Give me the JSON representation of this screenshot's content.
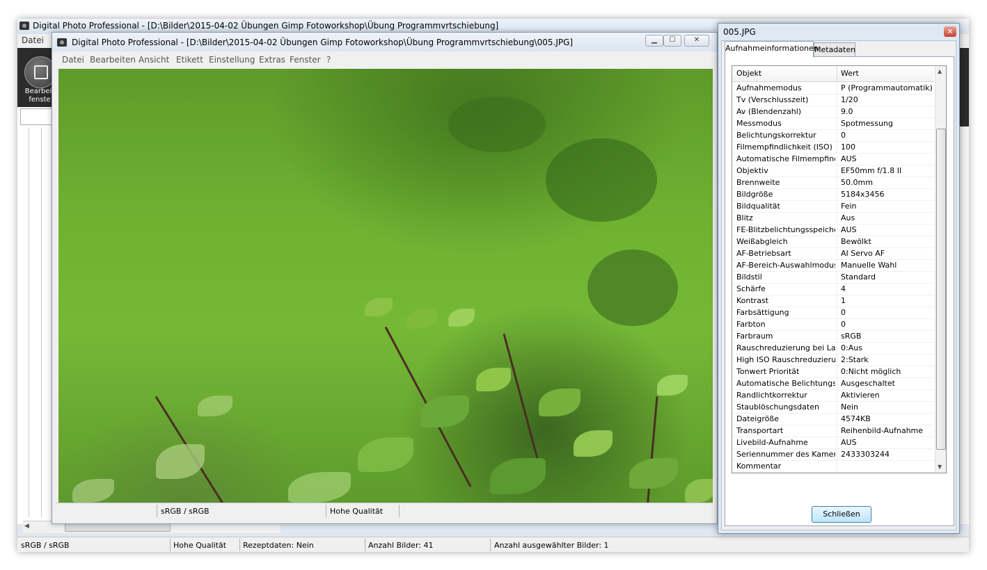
{
  "main_window": {
    "title": "Digital Photo Professional - [D:\\Bilder\\2015-04-02 Übungen  Gimp Fotoworkshop\\Übung Programmvrtschiebung]",
    "menu": [
      "Datei"
    ],
    "tool_label": "Bearbeit fenste",
    "status": {
      "color_space": "sRGB / sRGB",
      "quality": "Hohe Qualität",
      "recipe": "Rezeptdaten: Nein",
      "count": "Anzahl Bilder: 41",
      "selected": "Anzahl ausgewählter Bilder: 1"
    }
  },
  "image_window": {
    "title": "Digital Photo Professional - [D:\\Bilder\\2015-04-02 Übungen  Gimp Fotoworkshop\\Übung Programmvrtschiebung\\005.JPG]",
    "menu": [
      "Datei",
      "Bearbeiten",
      "Ansicht",
      "Etikett",
      "Einstellung",
      "Extras",
      "Fenster",
      "?"
    ],
    "status": {
      "color_space": "sRGB / sRGB",
      "quality": "Hohe Qualität"
    }
  },
  "info_dialog": {
    "title": "005.JPG",
    "close_glyph": "✕",
    "tabs": [
      "Aufnahmeinformationen",
      "Metadaten"
    ],
    "columns": [
      "Objekt",
      "Wert"
    ],
    "rows": [
      [
        "Aufnahmemodus",
        "P (Programmautomatik)"
      ],
      [
        "Tv (Verschlusszeit)",
        "1/20"
      ],
      [
        "Av (Blendenzahl)",
        "9.0"
      ],
      [
        "Messmodus",
        "Spotmessung"
      ],
      [
        "Belichtungskorrektur",
        "0"
      ],
      [
        "Filmempfindlichkeit (ISO)",
        "100"
      ],
      [
        "Automatische Filmempfindli...",
        "AUS"
      ],
      [
        "Objektiv",
        "EF50mm f/1.8 II"
      ],
      [
        "Brennweite",
        "50.0mm"
      ],
      [
        "Bildgröße",
        "5184x3456"
      ],
      [
        "Bildqualität",
        "Fein"
      ],
      [
        "Blitz",
        "Aus"
      ],
      [
        "FE-Blitzbelichtungsspeicher...",
        "AUS"
      ],
      [
        "Weißabgleich",
        "Bewölkt"
      ],
      [
        "AF-Betriebsart",
        "AI Servo AF"
      ],
      [
        "AF-Bereich-Auswahlmodus",
        "Manuelle  Wahl"
      ],
      [
        "Bildstil",
        "Standard"
      ],
      [
        "Schärfe",
        "4"
      ],
      [
        "Kontrast",
        "1"
      ],
      [
        "Farbsättigung",
        "0"
      ],
      [
        "Farbton",
        "0"
      ],
      [
        "Farbraum",
        "sRGB"
      ],
      [
        "Rauschreduzierung bei Lan...",
        "0:Aus"
      ],
      [
        "High ISO Rauschreduzierung",
        "2:Stark"
      ],
      [
        "Tonwert Priorität",
        "0:Nicht möglich"
      ],
      [
        "Automatische Belichtungso...",
        "Ausgeschaltet"
      ],
      [
        "Randlichtkorrektur",
        "Aktivieren"
      ],
      [
        "Staublöschungsdaten",
        "Nein"
      ],
      [
        "Dateigröße",
        "4574KB"
      ],
      [
        "Transportart",
        "Reihenbild-Aufnahme"
      ],
      [
        "Livebild-Aufnahme",
        "AUS"
      ],
      [
        "Seriennummer des Kamera...",
        "2433303244"
      ],
      [
        "Kommentar",
        ""
      ]
    ],
    "close_button": "Schließen"
  },
  "colors": {
    "grass": "#6fb232",
    "titlebar": "#dbe5f0",
    "dialog_button": "#bee6fd",
    "close_red": "#c5432f"
  }
}
